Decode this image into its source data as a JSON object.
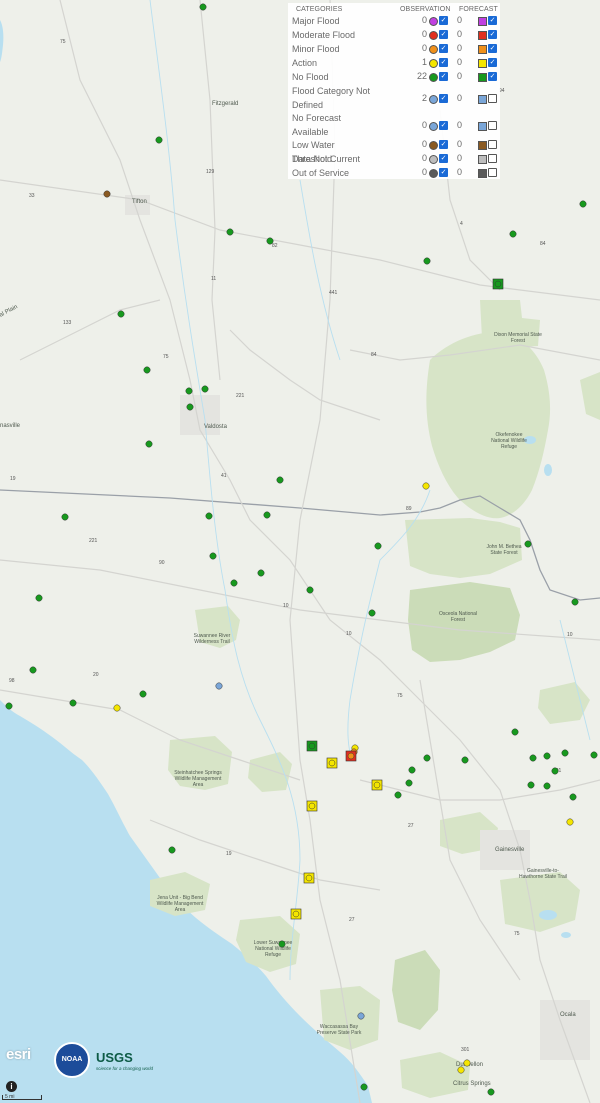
{
  "legend": {
    "header_categories": "CATEGORIES",
    "header_observation": "OBSERVATION",
    "header_forecast": "FORECAST",
    "rows": [
      {
        "label": "Major Flood",
        "obs_count": "0",
        "obs_color": "#c040e0",
        "obs_checked": true,
        "fc_count": "0",
        "fc_color": "#c040e0",
        "fc_checked": true
      },
      {
        "label": "Moderate Flood",
        "obs_count": "0",
        "obs_color": "#e03020",
        "obs_checked": true,
        "fc_count": "0",
        "fc_color": "#e03020",
        "fc_checked": true
      },
      {
        "label": "Minor Flood",
        "obs_count": "0",
        "obs_color": "#f0901a",
        "obs_checked": true,
        "fc_count": "0",
        "fc_color": "#f0901a",
        "fc_checked": true
      },
      {
        "label": "Action",
        "obs_count": "1",
        "obs_color": "#f5e600",
        "obs_checked": true,
        "fc_count": "0",
        "fc_color": "#f5e600",
        "fc_checked": true
      },
      {
        "label": "No Flood",
        "obs_count": "22",
        "obs_color": "#17991e",
        "obs_checked": true,
        "fc_count": "0",
        "fc_color": "#17991e",
        "fc_checked": true
      },
      {
        "label": "Flood Category Not Defined",
        "obs_count": "2",
        "obs_color": "#7aa6d8",
        "obs_checked": true,
        "fc_count": "0",
        "fc_color": "#7aa6d8",
        "fc_checked": false
      },
      {
        "label": "No Forecast Available",
        "obs_count": "0",
        "obs_color": "#7aa6d8",
        "obs_checked": true,
        "fc_count": "0",
        "fc_color": "#7aa6d8",
        "fc_checked": false
      },
      {
        "label": "Low Water Threshold",
        "obs_count": "0",
        "obs_color": "#8a5a22",
        "obs_checked": true,
        "fc_count": "0",
        "fc_color": "#8a5a22",
        "fc_checked": false
      },
      {
        "label": "Data Not Current",
        "obs_count": "0",
        "obs_color": "#bdbdbd",
        "obs_checked": true,
        "fc_count": "0",
        "fc_color": "#bdbdbd",
        "fc_checked": false
      },
      {
        "label": "Out of Service",
        "obs_count": "0",
        "obs_color": "#5a5a5a",
        "obs_checked": true,
        "fc_count": "0",
        "fc_color": "#5a5a5a",
        "fc_checked": false
      }
    ]
  },
  "places": {
    "fitzgerald": "Fitzgerald",
    "tifton": "Tifton",
    "valdosta": "Valdosta",
    "nasville": "nasville",
    "plain": "al Plain",
    "gainesville": "Gainesville",
    "ocala": "Ocala",
    "dunnellon": "Dunnellon",
    "citrus_springs": "Citrus Springs",
    "dixon": "Dixon Memorial State Forest",
    "okefenokee": "Okefenokee National Wildlife Refuge",
    "bethea": "John M. Bethea State Forest",
    "osceola": "Osceola National Forest",
    "suwannee_trail": "Suwannee River Wilderness Trail",
    "steinhatchee": "Steinhatchee Springs Wildlife Management Area",
    "big_bend": "Jena Unit - Big Bend Wildlife Management Area",
    "lower_suwannee": "Lower Suwannee National Wildlife Refuge",
    "gainesville_hawthorne": "Gainesville-to-Hawthorne State Trail",
    "waccasassa": "Waccasassa Bay Preserve State Park"
  },
  "highways": [
    "75",
    "33",
    "129",
    "82",
    "11",
    "441",
    "84",
    "133",
    "75",
    "221",
    "84",
    "41",
    "19",
    "221",
    "90",
    "89",
    "10",
    "10",
    "98",
    "20",
    "75",
    "19",
    "27",
    "301",
    "75",
    "4",
    "94",
    "10",
    "301",
    "27"
  ],
  "attribution": {
    "esri": "esri",
    "noaa": "NOAA",
    "usgs": "USGS",
    "usgs_tag": "science for a changing world",
    "info": "i",
    "scale": "5 mi"
  },
  "gauges": {
    "observation_circles": [
      {
        "status": "no-flood"
      },
      {
        "status": "no-flood"
      },
      {
        "status": "low-water"
      },
      {
        "status": "no-flood"
      },
      {
        "status": "no-flood"
      },
      {
        "status": "no-flood"
      },
      {
        "status": "no-flood"
      },
      {
        "status": "no-flood"
      },
      {
        "status": "no-flood"
      },
      {
        "status": "no-flood"
      },
      {
        "status": "action"
      },
      {
        "status": "no-flood"
      },
      {
        "status": "no-flood"
      },
      {
        "status": "not-defined"
      },
      {
        "status": "action"
      }
    ]
  }
}
